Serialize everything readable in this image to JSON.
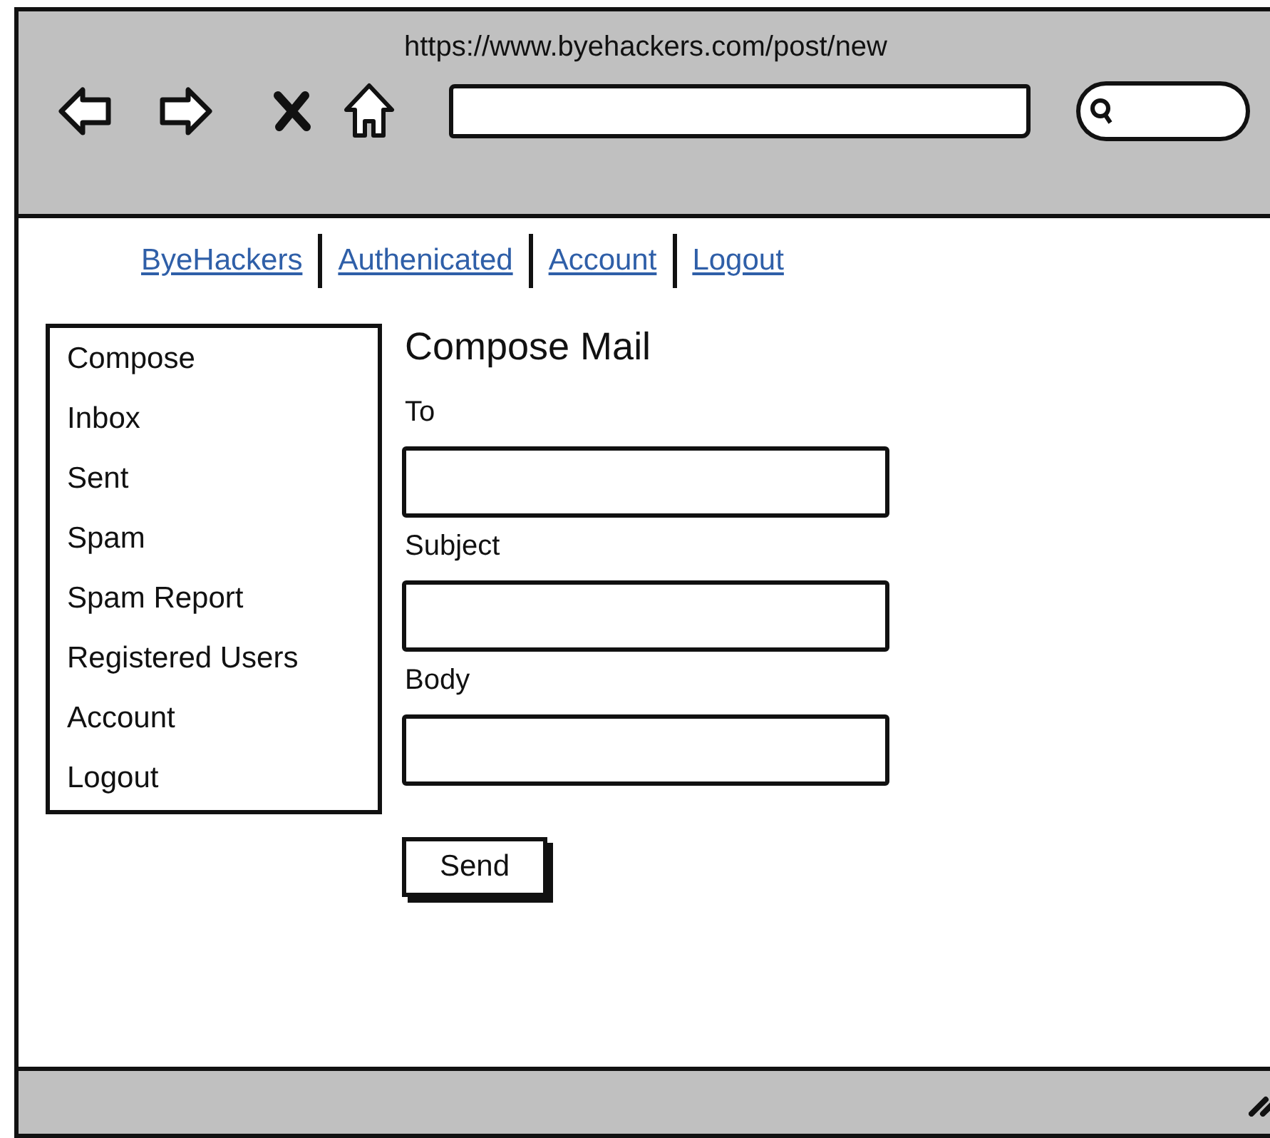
{
  "browser": {
    "url": "https://www.byehackers.com/post/new"
  },
  "top_links": [
    "ByeHackers",
    "Authenicated",
    "Account",
    "Logout"
  ],
  "sidebar": {
    "items": [
      "Compose",
      "Inbox",
      "Sent",
      "Spam",
      "Spam Report",
      "Registered Users",
      "Account",
      "Logout"
    ]
  },
  "form": {
    "title": "Compose Mail",
    "fields": [
      {
        "label": "To"
      },
      {
        "label": "Subject"
      },
      {
        "label": "Body"
      }
    ],
    "button": "Send"
  }
}
